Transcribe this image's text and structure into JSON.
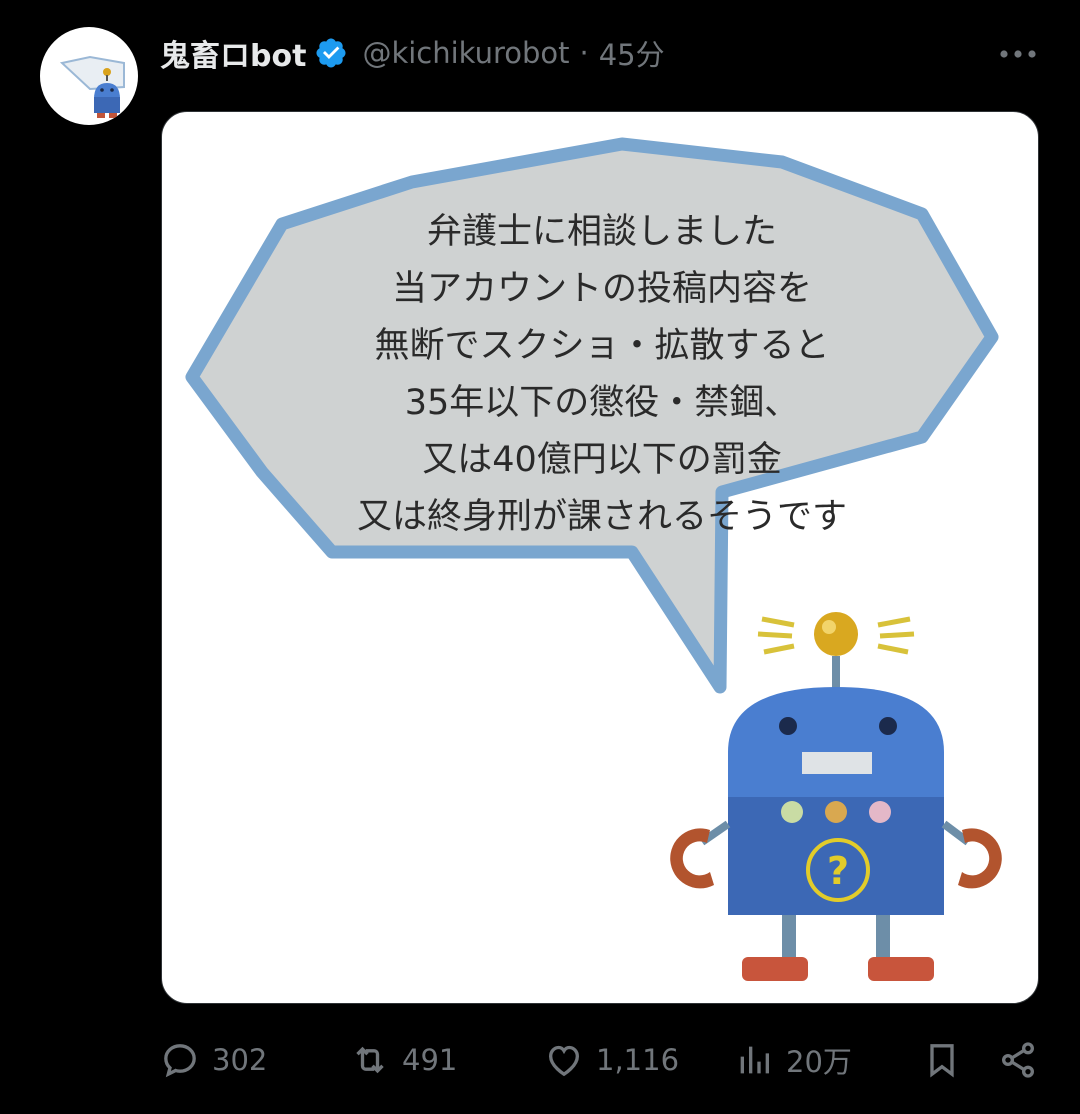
{
  "post": {
    "display_name": "鬼畜ロbot",
    "handle": "@kichikurobot",
    "separator": "·",
    "time": "45分",
    "image_text": [
      "弁護士に相談しました",
      "当アカウントの投稿内容を",
      "無断でスクショ・拡散すると",
      "35年以下の懲役・禁錮、",
      "又は40億円以下の罰金",
      "又は終身刑が課されるそうです"
    ]
  },
  "actions": {
    "reply_count": "302",
    "repost_count": "491",
    "like_count": "1,116",
    "view_count": "20万"
  },
  "colors": {
    "background": "#000000",
    "primary_text": "#e7e9ea",
    "secondary_text": "#71767b",
    "verified_blue": "#1d9bf0",
    "bubble_fill": "#cfd2d2",
    "bubble_outline": "#7aa6cf",
    "robot_blue": "#3f6fc0"
  },
  "icons": {
    "verified": "verified-badge-icon",
    "more": "more-dots-icon",
    "reply": "reply-icon",
    "repost": "repost-icon",
    "like": "heart-icon",
    "views": "views-icon",
    "bookmark": "bookmark-icon",
    "share": "share-icon"
  }
}
